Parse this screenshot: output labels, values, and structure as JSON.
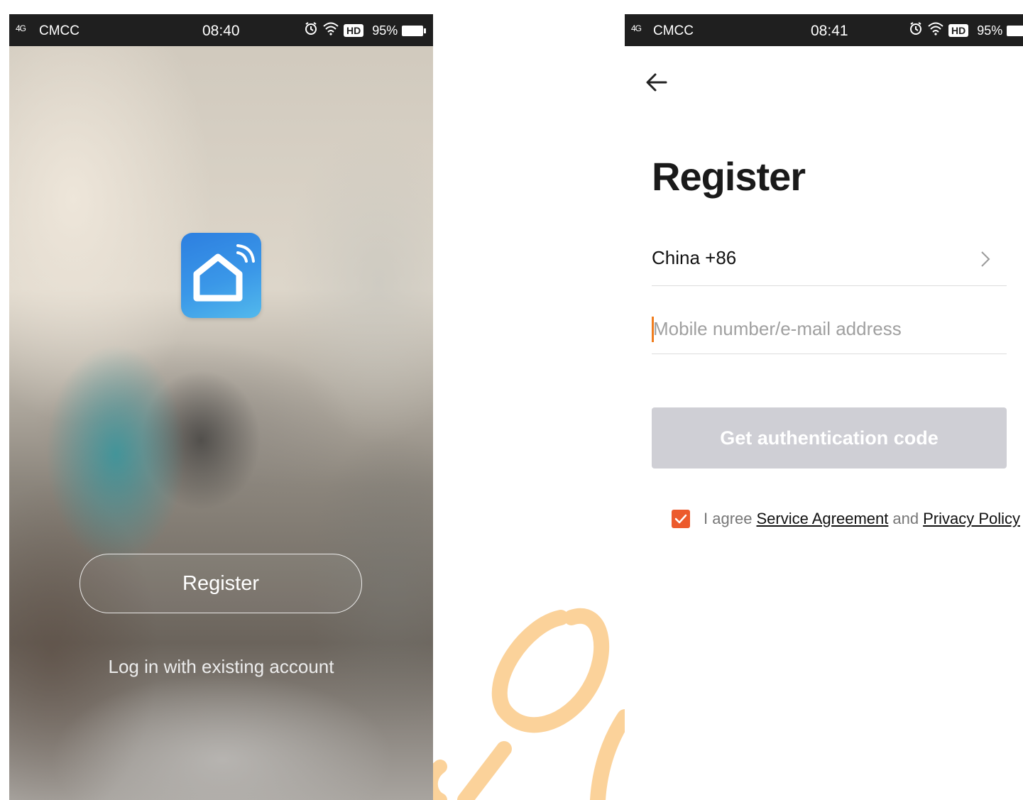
{
  "left_screen": {
    "status_bar": {
      "network": "4G",
      "carrier": "CMCC",
      "time": "08:40",
      "hd": "HD",
      "battery": "95%"
    },
    "app_icon": "smart-home-icon",
    "register_label": "Register",
    "login_label": "Log in with existing account"
  },
  "right_screen": {
    "status_bar": {
      "network": "4G",
      "carrier": "CMCC",
      "time": "08:41",
      "hd": "HD",
      "battery": "95%"
    },
    "title": "Register",
    "country": "China +86",
    "input_placeholder": "Mobile number/e-mail address",
    "input_value": "",
    "auth_button_label": "Get authentication code",
    "agreement": {
      "checked": true,
      "prefix": "I agree",
      "service_link": "Service Agreement",
      "conjunction": "and",
      "privacy_link": "Privacy Policy"
    }
  },
  "colors": {
    "status_bar": "#1f1f1f",
    "accent_orange": "#ec5a2c",
    "caret": "#f07d1e",
    "disabled_button": "#cfcfd5",
    "logo_blue": "#3a97e8",
    "watermark": "#fbd29a"
  }
}
